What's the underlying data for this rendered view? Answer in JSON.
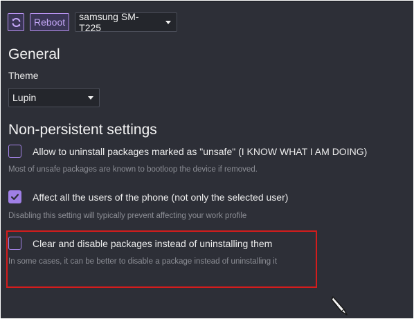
{
  "toolbar": {
    "refresh_icon": "refresh-icon",
    "reboot_label": "Reboot",
    "device_selected": "samsung SM-T225"
  },
  "general": {
    "heading": "General",
    "theme_label": "Theme",
    "theme_selected": "Lupin"
  },
  "non_persistent": {
    "heading": "Non-persistent settings",
    "settings": [
      {
        "label": "Allow to uninstall packages marked as \"unsafe\" (I KNOW WHAT I AM DOING)",
        "description": "Most of unsafe packages are known to bootloop the device if removed.",
        "checked": false
      },
      {
        "label": "Affect all the users of the phone (not only the selected user)",
        "description": "Disabling this setting will typically prevent affecting your work profile",
        "checked": true
      },
      {
        "label": "Clear and disable packages instead of uninstalling them",
        "description": "In some cases, it can be better to disable a package instead of uninstalling it",
        "checked": false
      }
    ]
  },
  "colors": {
    "background": "#2d2f37",
    "accent": "#9f7fe6",
    "highlight": "#d41c1c"
  }
}
